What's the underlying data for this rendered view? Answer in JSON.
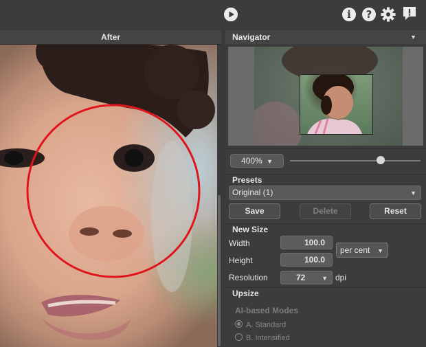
{
  "toolbar": {
    "icons": [
      "play-icon",
      "info-icon",
      "help-icon",
      "gear-icon",
      "feedback-icon"
    ],
    "info_glyph": "i",
    "help_glyph": "?"
  },
  "image_panel": {
    "header": "After"
  },
  "navigator": {
    "title": "Navigator",
    "zoom": "400%"
  },
  "presets": {
    "title": "Presets",
    "selected": "Original (1)",
    "save_label": "Save",
    "delete_label": "Delete",
    "reset_label": "Reset"
  },
  "new_size": {
    "title": "New Size",
    "width_label": "Width",
    "width_value": "100.0",
    "height_label": "Height",
    "height_value": "100.0",
    "unit": "per cent",
    "resolution_label": "Resolution",
    "resolution_value": "72",
    "resolution_unit": "dpi"
  },
  "upsize": {
    "title": "Upsize",
    "modes_label": "AI-based Modes",
    "modes": [
      {
        "label": "A. Standard",
        "selected": true
      },
      {
        "label": "B. Intensified",
        "selected": false
      }
    ]
  },
  "colors": {
    "accent_circle": "#e0141b",
    "panel_bg": "#3c3c3c"
  }
}
